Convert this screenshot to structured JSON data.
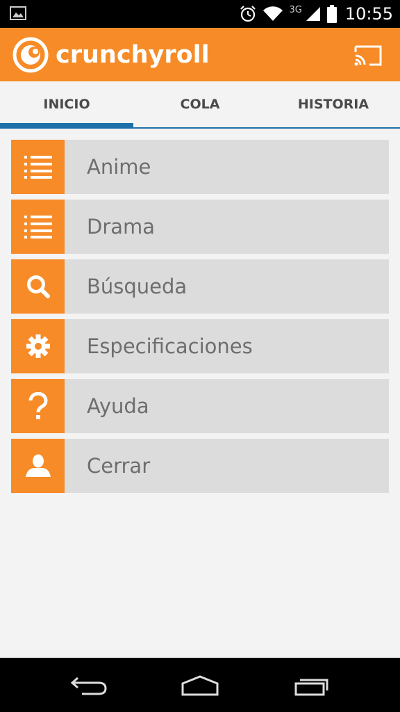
{
  "status_bar": {
    "network": "3G",
    "time": "10:55"
  },
  "app_bar": {
    "brand": "crunchyroll",
    "brand_color": "#f78b27"
  },
  "tabs": [
    {
      "label": "INICIO",
      "active": true
    },
    {
      "label": "COLA",
      "active": false
    },
    {
      "label": "HISTORIA",
      "active": false
    }
  ],
  "menu": [
    {
      "label": "Anime",
      "icon": "list-icon"
    },
    {
      "label": "Drama",
      "icon": "list-icon"
    },
    {
      "label": "Búsqueda",
      "icon": "search-icon"
    },
    {
      "label": "Especificaciones",
      "icon": "gear-icon"
    },
    {
      "label": "Ayuda",
      "icon": "help-icon"
    },
    {
      "label": "Cerrar",
      "icon": "user-icon"
    }
  ],
  "colors": {
    "accent": "#f78b27",
    "tab_indicator": "#1f6fa9",
    "menu_bg": "#dcdcdc",
    "page_bg": "#f3f3f3"
  }
}
